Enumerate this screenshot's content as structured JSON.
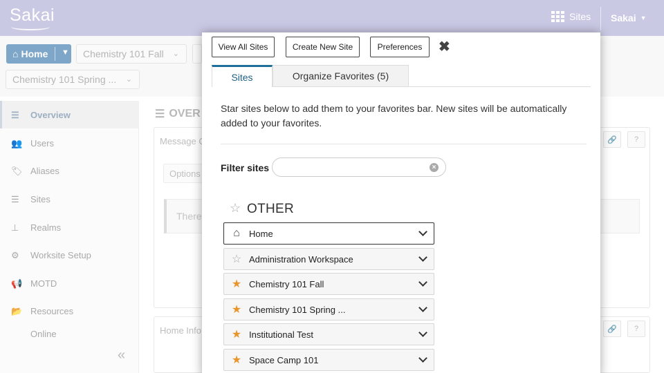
{
  "header": {
    "logo_text": "Sakai",
    "sites_label": "Sites",
    "user_label": "Sakai"
  },
  "site_nav": {
    "home_label": "Home",
    "tabs": [
      "Chemistry 101 Fall",
      "Chemistry 101 Spring ..."
    ]
  },
  "tool_menu": {
    "items": [
      {
        "label": "Overview",
        "icon": "list-icon",
        "active": true
      },
      {
        "label": "Users",
        "icon": "users-icon"
      },
      {
        "label": "Aliases",
        "icon": "tag-icon"
      },
      {
        "label": "Sites",
        "icon": "list-icon"
      },
      {
        "label": "Realms",
        "icon": "sitemap-icon"
      },
      {
        "label": "Worksite Setup",
        "icon": "gears-icon"
      },
      {
        "label": "MOTD",
        "icon": "megaphone-icon"
      },
      {
        "label": "Resources",
        "icon": "folder-icon"
      },
      {
        "label": "Online",
        "icon": "user-icon"
      }
    ]
  },
  "main": {
    "page_title": "OVER",
    "panel1_title": "Message O",
    "options_label": "Options",
    "notice_text": "There",
    "panel2_title": "Home Info",
    "link_label": "🔗",
    "help_label": "?"
  },
  "dialog": {
    "buttons": {
      "view_all": "View All Sites",
      "create_new": "Create New Site",
      "preferences": "Preferences"
    },
    "tabs": {
      "sites": "Sites",
      "organize": "Organize Favorites (5)"
    },
    "instructions": "Star sites below to add them to your favorites bar. New sites will be automatically added to your favorites.",
    "filter": {
      "label": "Filter sites",
      "value": "",
      "placeholder": ""
    },
    "group_title": "OTHER",
    "sites": [
      {
        "label": "Home",
        "icon": "home-icon",
        "favorite": false,
        "current": true
      },
      {
        "label": "Administration Workspace",
        "icon": "star-outline-icon",
        "favorite": false
      },
      {
        "label": "Chemistry 101 Fall",
        "icon": "star-icon",
        "favorite": true
      },
      {
        "label": "Chemistry 101 Spring ...",
        "icon": "star-icon",
        "favorite": true
      },
      {
        "label": "Institutional Test",
        "icon": "star-icon",
        "favorite": true
      },
      {
        "label": "Space Camp 101",
        "icon": "star-icon",
        "favorite": true
      }
    ]
  },
  "colors": {
    "header_bg": "#c9c9e4",
    "active_tab_border": "#1e6e9a",
    "favorite_star": "#e8962c",
    "home_pill": "#7ea6c8"
  }
}
